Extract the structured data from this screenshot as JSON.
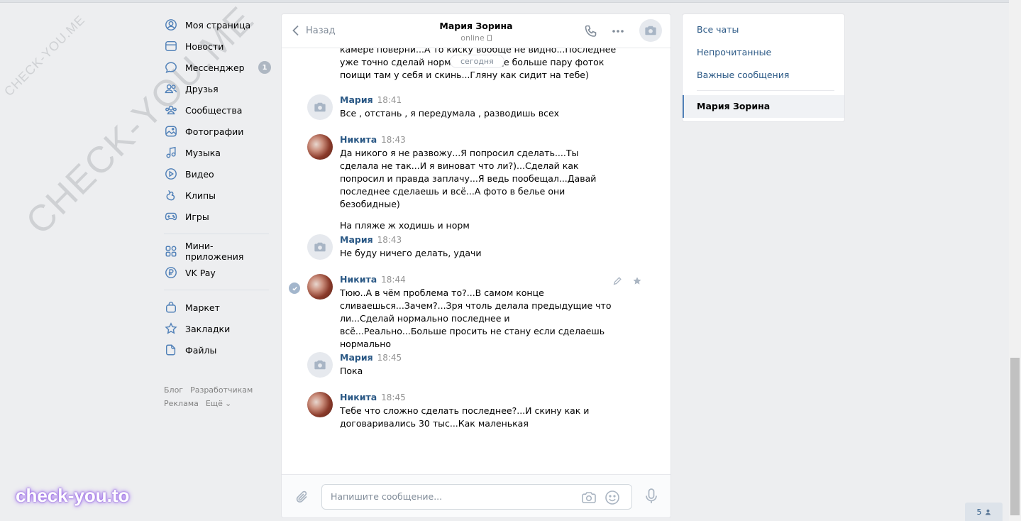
{
  "watermark": {
    "small": "CHECK-YOU.ME",
    "big": "CHECK-YOU.ME",
    "brand": "check-you.to"
  },
  "nav": {
    "items": [
      {
        "label": "Моя страница"
      },
      {
        "label": "Новости"
      },
      {
        "label": "Мессенджер",
        "badge": "1"
      },
      {
        "label": "Друзья"
      },
      {
        "label": "Сообщества"
      },
      {
        "label": "Фотографии"
      },
      {
        "label": "Музыка"
      },
      {
        "label": "Видео"
      },
      {
        "label": "Клипы"
      },
      {
        "label": "Игры"
      },
      {
        "label": "Мини-приложения"
      },
      {
        "label": "VK Pay"
      },
      {
        "label": "Маркет"
      },
      {
        "label": "Закладки"
      },
      {
        "label": "Файлы"
      }
    ]
  },
  "footer": {
    "blog": "Блог",
    "dev": "Разработчикам",
    "ads": "Реклама",
    "more": "Ещё"
  },
  "chat": {
    "back_label": "Назад",
    "title": "Мария Зорина",
    "status": "online",
    "date_pill": "сегодня",
    "partial_text": "камере поверни...А то киску вообще не видно...Последнее уже точно сделай нормально и еще больше пару фоток поищи там у себя и скинь...Гляну как сидит на тебе)",
    "messages": [
      {
        "author": "Мария",
        "time": "18:41",
        "text": "Все , отстань , я передумала , разводишь всех"
      },
      {
        "author": "Никита",
        "time": "18:43",
        "text": "Да никого я не развожу...Я попросил сделать....Ты сделала не так...И я виноват что ли?)...Сделай как попросил и правда заплачу...Я ведь пообещал...Давай последнее сделаешь и всё...А фото в белье они безобидные)",
        "text2": "На пляже ж ходишь и норм"
      },
      {
        "author": "Мария",
        "time": "18:43",
        "text": "Не буду ничего делать, удачи"
      },
      {
        "author": "Никита",
        "time": "18:44",
        "text": "Тюю..А в чём проблема то?...В самом конце сливаешься...Зачем?...Зря чтоль делала предыдущие что ли...Сделай нормально последнее и всё...Реально...Больше просить не стану если сделаешь нормально"
      },
      {
        "author": "Мария",
        "time": "18:45",
        "text": "Пока"
      },
      {
        "author": "Никита",
        "time": "18:45",
        "text": "Тебе что сложно сделать последнее?...И скину как и договаривались 30 тыс...Как маленькая"
      }
    ],
    "composer": {
      "placeholder": "Напишите сообщение..."
    }
  },
  "right_panel": {
    "all_chats": "Все чаты",
    "unread": "Непрочитанные",
    "important": "Важные сообщения",
    "active_chat": "Мария Зорина"
  },
  "online_count": "5",
  "colors": {
    "link": "#2a5885",
    "background": "#edeef0",
    "accent": "#5181b8"
  }
}
